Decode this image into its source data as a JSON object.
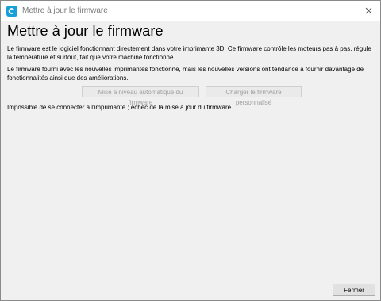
{
  "window": {
    "title": "Mettre à jour le firmware",
    "app_icon": "cura-logo-icon",
    "close_icon": "close-icon"
  },
  "main": {
    "heading": "Mettre à jour le firmware",
    "paragraph1": "Le firmware est le logiciel fonctionnant directement dans votre imprimante 3D. Ce firmware contrôle les moteurs pas à pas, régule la température et surtout, fait que votre machine fonctionne.",
    "paragraph2": "Le firmware fourni avec les nouvelles imprimantes fonctionne, mais les nouvelles versions ont tendance à fournir davantage de fonctionnalités ainsi que des améliorations.",
    "buttons": {
      "auto_upgrade_label": "Mise à niveau automatique du firmware",
      "custom_upload_label": "Charger le firmware personnalisé"
    },
    "status": "Impossible de se connecter à l'imprimante ; échec de la mise à jour du firmware."
  },
  "footer": {
    "close_label": "Fermer"
  },
  "colors": {
    "accent": "#1aa0d8",
    "background": "#f0f0f0",
    "disabled_text": "#a0a0a0"
  }
}
